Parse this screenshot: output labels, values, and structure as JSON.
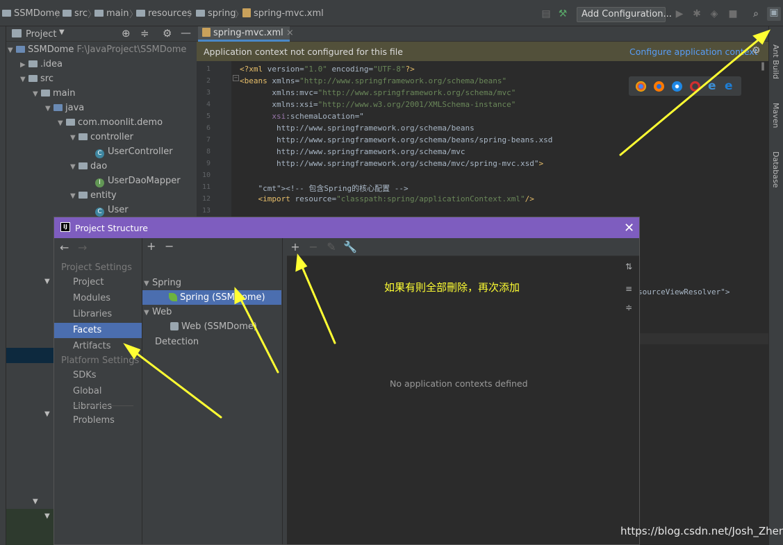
{
  "breadcrumb": [
    "SSMDome",
    "src",
    "main",
    "resources",
    "spring",
    "spring-mvc.xml"
  ],
  "toolbar": {
    "add_configuration": "Add Configuration..."
  },
  "project_panel": {
    "title": "Project",
    "tree": [
      {
        "label": "SSMDome",
        "extra": "F:\\JavaProject\\SSMDome",
        "depth": 0,
        "kind": "module",
        "expanded": true
      },
      {
        "label": ".idea",
        "depth": 1,
        "kind": "folder",
        "expanded": false
      },
      {
        "label": "src",
        "depth": 1,
        "kind": "folder",
        "expanded": true
      },
      {
        "label": "main",
        "depth": 2,
        "kind": "folder",
        "expanded": true
      },
      {
        "label": "java",
        "depth": 3,
        "kind": "source",
        "expanded": true
      },
      {
        "label": "com.moonlit.demo",
        "depth": 4,
        "kind": "package",
        "expanded": true
      },
      {
        "label": "controller",
        "depth": 5,
        "kind": "package",
        "expanded": true
      },
      {
        "label": "UserController",
        "depth": 6,
        "kind": "class"
      },
      {
        "label": "dao",
        "depth": 5,
        "kind": "package",
        "expanded": true
      },
      {
        "label": "UserDaoMapper",
        "depth": 6,
        "kind": "interface"
      },
      {
        "label": "entity",
        "depth": 5,
        "kind": "package",
        "expanded": true
      },
      {
        "label": "User",
        "depth": 6,
        "kind": "class"
      }
    ]
  },
  "editor": {
    "tab": "spring-mvc.xml",
    "banner": "Application context not configured for this file",
    "banner_link": "Configure application context",
    "line_numbers": [
      "1",
      "2",
      "3",
      "4",
      "5",
      "6",
      "7",
      "8",
      "9",
      "10",
      "11",
      "12",
      "13"
    ],
    "lines": [
      "<?xml version=\"1.0\" encoding=\"UTF-8\"?>",
      "<beans xmlns=\"http://www.springframework.org/schema/beans\"",
      "       xmlns:mvc=\"http://www.springframework.org/schema/mvc\"",
      "       xmlns:xsi=\"http://www.w3.org/2001/XMLSchema-instance\"",
      "       xsi:schemaLocation=\"",
      "        http://www.springframework.org/schema/beans",
      "        http://www.springframework.org/schema/beans/spring-beans.xsd",
      "        http://www.springframework.org/schema/mvc",
      "        http://www.springframework.org/schema/mvc/spring-mvc.xsd\">",
      "",
      "    <!-- 包含Spring的核心配置 -->",
      "    <import resource=\"classpath:spring/applicationContext.xml\"/>",
      ""
    ],
    "partial_line": "sourceViewResolver\">"
  },
  "right_stripe": [
    "Ant Build",
    "Maven",
    "Database"
  ],
  "dialog": {
    "title": "Project Structure",
    "nav": {
      "project_settings": "Project Settings",
      "items1": [
        "Project",
        "Modules",
        "Libraries",
        "Facets",
        "Artifacts"
      ],
      "platform_settings": "Platform Settings",
      "items2": [
        "SDKs",
        "Global Libraries"
      ],
      "problems": "Problems",
      "selected": "Facets"
    },
    "facets": {
      "spring_group": "Spring",
      "spring_item": "Spring (SSMDome)",
      "web_group": "Web",
      "web_item": "Web (SSMDome)",
      "detection": "Detection"
    },
    "main": {
      "empty_text": "No application contexts defined"
    }
  },
  "annotation": "如果有則全部刪除，再次添加",
  "watermark": "https://blog.csdn.net/Josh_Zhen",
  "colors": {
    "accent": "#4b6eaf",
    "dialog_title": "#7e5dbf",
    "arrow": "#ffff33"
  }
}
